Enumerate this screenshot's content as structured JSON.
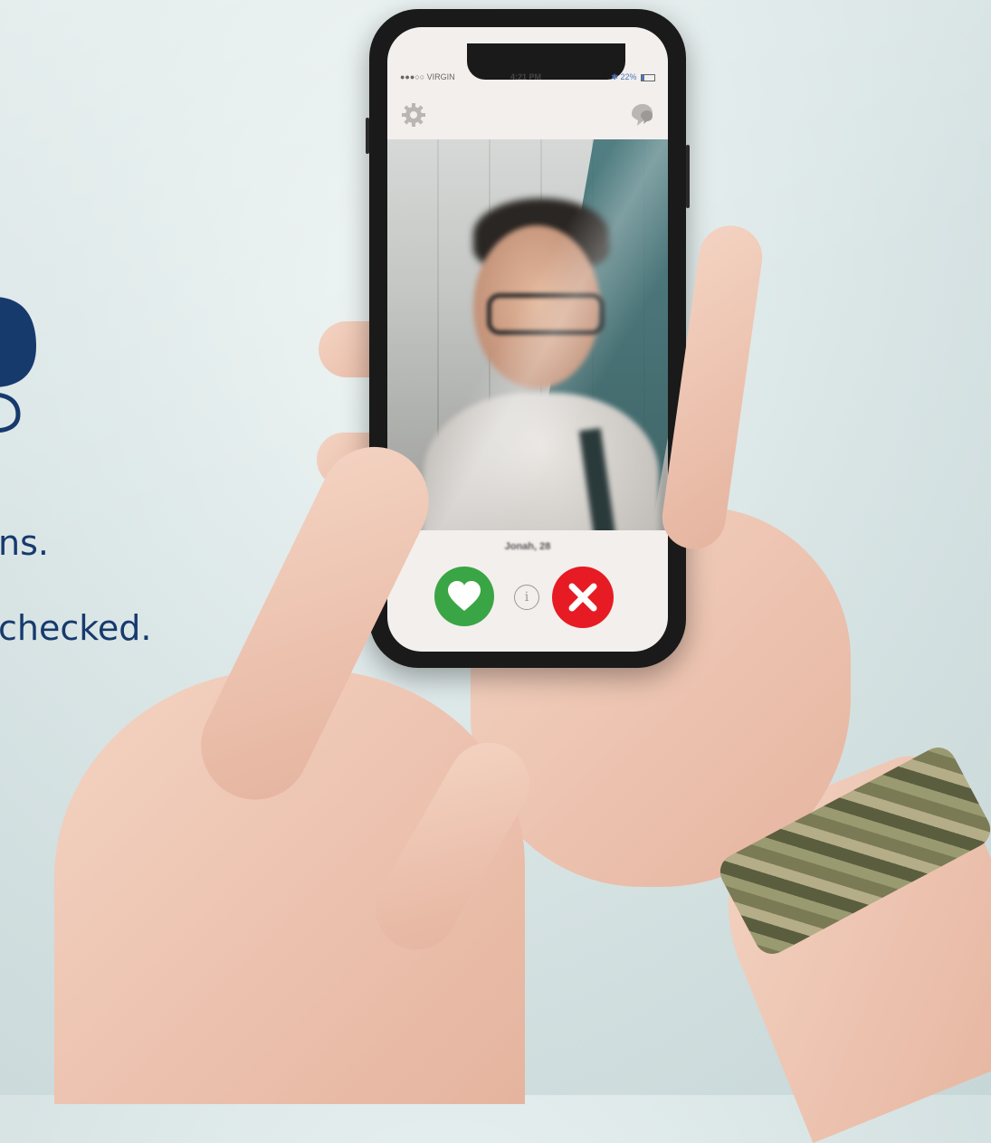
{
  "side_text": {
    "line1": "ns.",
    "line2": "checked."
  },
  "phone": {
    "status_bar": {
      "carrier": "●●●○○ VIRGIN",
      "time": "4:21 PM",
      "battery": "22%"
    },
    "toolbar": {
      "left_icon": "gear-icon",
      "right_icon": "chat-icon"
    },
    "profile": {
      "name": "Jonah, 28"
    },
    "actions": {
      "info_label": "i"
    }
  },
  "colors": {
    "text_accent": "#173a6d",
    "like": "#3aa544",
    "nope": "#e61b23",
    "status_accent": "#4a76b8"
  }
}
